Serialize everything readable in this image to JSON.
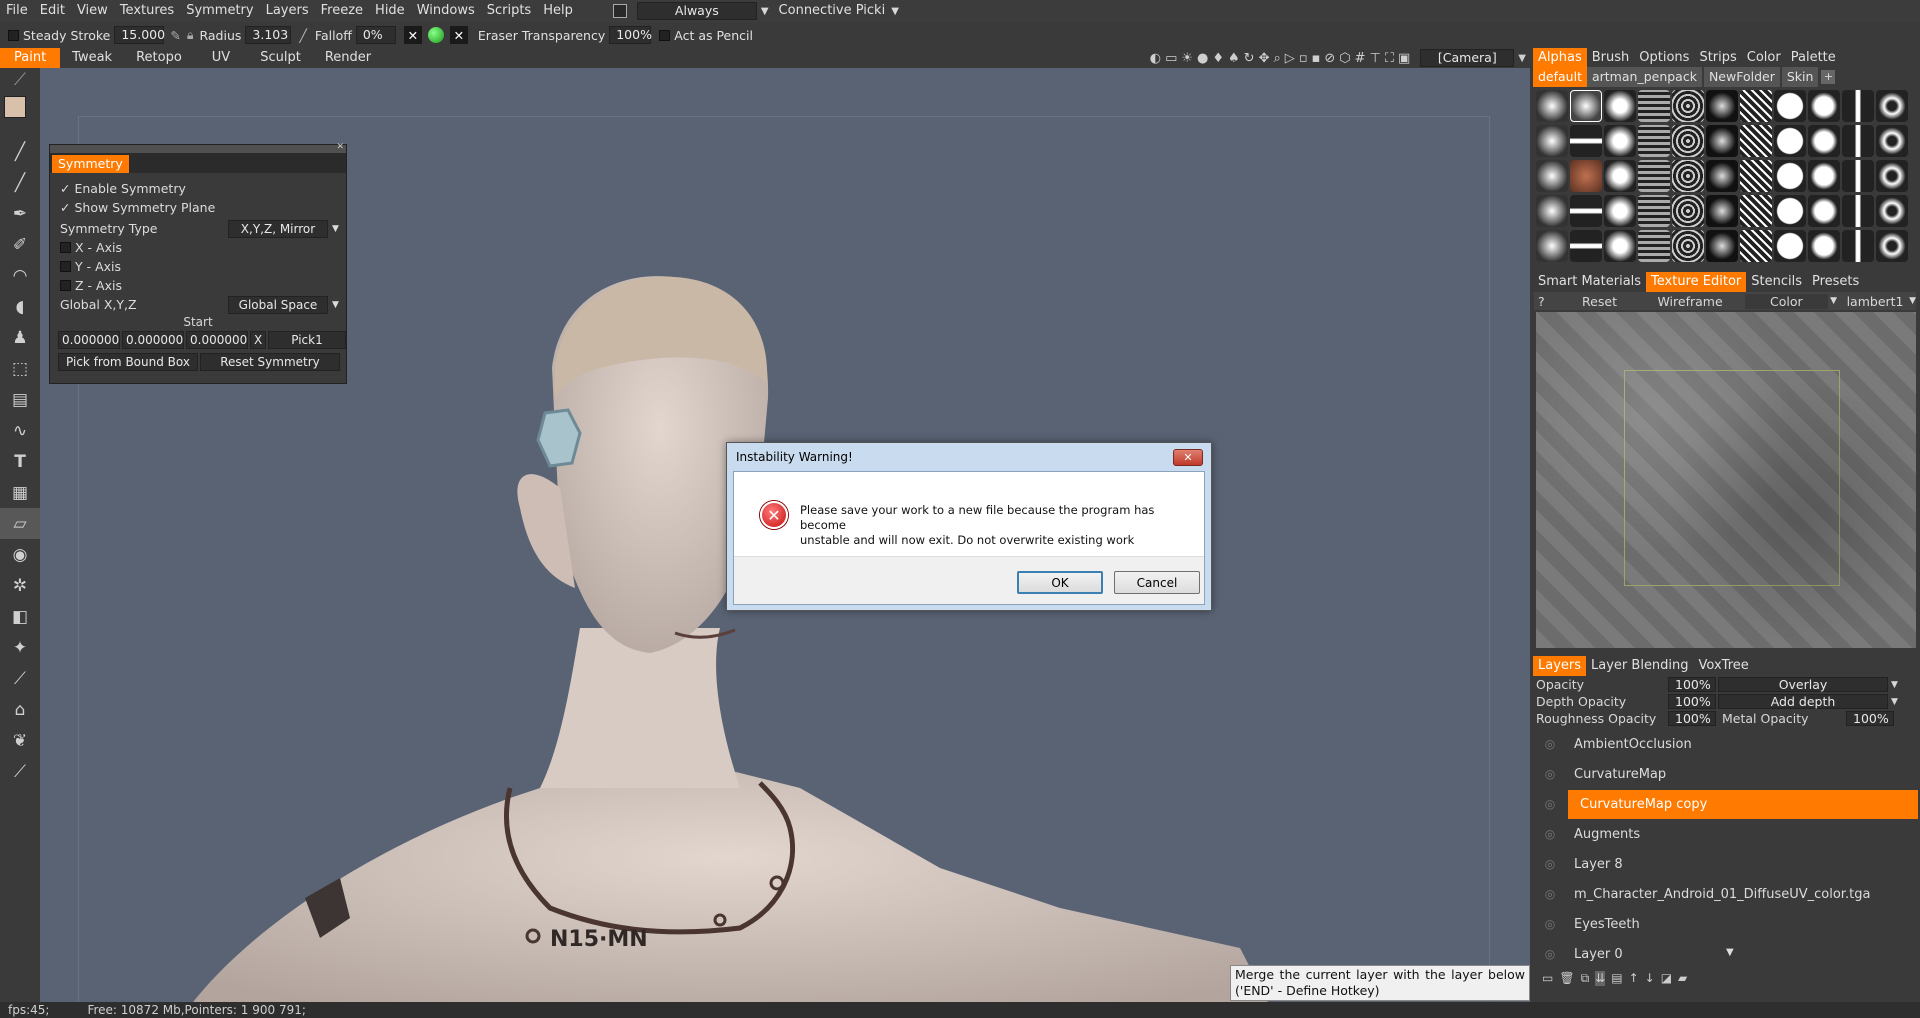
{
  "menu": [
    "File",
    "Edit",
    "View",
    "Textures",
    "Symmetry",
    "Layers",
    "Freeze",
    "Hide",
    "Windows",
    "Scripts",
    "Help"
  ],
  "menu_right": {
    "always_label": "Always",
    "connective_label": "Connective Picki"
  },
  "toolbar": {
    "steady_stroke_label": "Steady Stroke",
    "steady_stroke_value": "15.000",
    "radius_label": "Radius",
    "radius_value": "3.103",
    "falloff_label": "Falloff",
    "falloff_value": "0%",
    "eraser_label": "Eraser Transparency",
    "eraser_value": "100%",
    "pencil_label": "Act as Pencil"
  },
  "mode_tabs": [
    "Paint",
    "Tweak",
    "Retopo",
    "UV",
    "Sculpt",
    "Render"
  ],
  "camera_label": "[Camera]",
  "symmetry_panel": {
    "title": "Symmetry",
    "enable": "Enable Symmetry",
    "show_plane": "Show Symmetry Plane",
    "type_label": "Symmetry Type",
    "type_value": "X,Y,Z, Mirror",
    "x_axis": "X - Axis",
    "y_axis": "Y - Axis",
    "z_axis": "Z - Axis",
    "global_label": "Global X,Y,Z",
    "global_value": "Global Space",
    "start_label": "Start",
    "start_x": "0.000000",
    "start_y": "0.000000",
    "start_z": "0.000000",
    "x_btn": "X",
    "pick_btn": "Pick1",
    "pick_bound_btn": "Pick from Bound Box",
    "reset_btn": "Reset Symmetry"
  },
  "dialog": {
    "title": "Instability Warning!",
    "message_line1": "Please save your work to a new file because the program has become",
    "message_line2": "unstable and will now exit. Do not overwrite existing work",
    "ok": "OK",
    "cancel": "Cancel"
  },
  "tattoo_text": "N15·MN",
  "right_tabs_top": [
    "Alphas",
    "Brush",
    "Options",
    "Strips",
    "Color",
    "Palette"
  ],
  "alpha_folders": [
    "default",
    "artman_penpack",
    "NewFolder",
    "Skin"
  ],
  "right_tabs_mid": [
    "Smart Materials",
    "Texture Editor",
    "Stencils",
    "Presets"
  ],
  "texture_toolbar": {
    "help": "?",
    "reset": "Reset",
    "wireframe": "Wireframe",
    "color": "Color",
    "material": "lambert1"
  },
  "layers_tabs": [
    "Layers",
    "Layer Blending",
    "VoxTree"
  ],
  "layer_props": {
    "opacity_label": "Opacity",
    "opacity_value": "100%",
    "blend": "Overlay",
    "depth_label": "Depth Opacity",
    "depth_value": "100%",
    "depth_mode": "Add depth",
    "rough_label": "Roughness Opacity",
    "rough_value": "100%",
    "metal_label": "Metal Opacity",
    "metal_value": "100%"
  },
  "layers": [
    "AmbientOcclusion",
    "CurvatureMap",
    "CurvatureMap copy",
    "Augments",
    "Layer 8",
    "m_Character_Android_01_DiffuseUV_color.tga",
    "EyesTeeth",
    "Layer 0"
  ],
  "tooltip": {
    "line1": "Merge the current layer with the layer below",
    "line2": "('END' - Define Hotkey)"
  },
  "status": {
    "fps": "fps:45;",
    "free": "Free: 10872 Mb,Pointers: 1 900 791;"
  },
  "colors": {
    "accent": "#ff7a00",
    "viewport_bg": "#596374",
    "panel": "#3a3a3a"
  }
}
